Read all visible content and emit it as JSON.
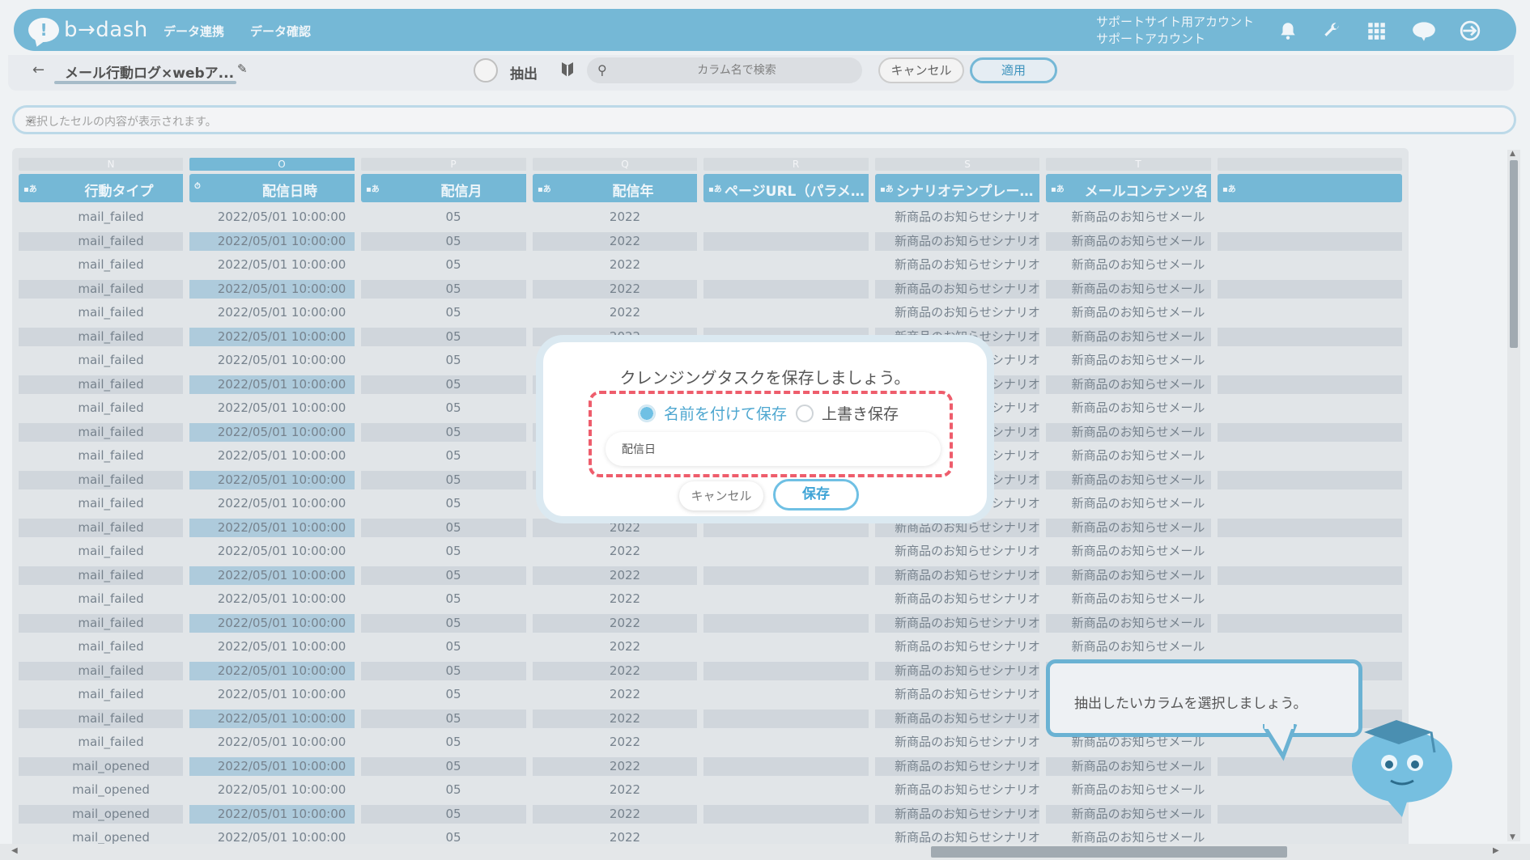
{
  "brand": {
    "logo_text": "b→dash",
    "accent": "#6ab2d3",
    "alert": "#ee5d6c"
  },
  "nav": {
    "links": [
      "データ連携",
      "データ確認"
    ],
    "account_line1": "サポートサイト用アカウント",
    "account_line2": "サポートアカウント",
    "icons": [
      "bell-icon",
      "wrench-icon",
      "grid-icon",
      "notification-cloud-icon",
      "logout-icon"
    ]
  },
  "toolbar": {
    "back": "←",
    "title": "メール行動ログ×webア...",
    "edit": "✎",
    "extract_label": "抽出",
    "search_placeholder": "カラム名で検索",
    "cancel_label": "キャンセル",
    "apply_label": "適用"
  },
  "cellbar": {
    "text": "選択したセルの内容が表示されます。",
    "chevron": "⌄"
  },
  "columns": [
    {
      "letter": "N",
      "type": "▪あ",
      "label": "行動タイプ",
      "selected": false
    },
    {
      "letter": "O",
      "type": "⏱",
      "label": "配信日時",
      "selected": true
    },
    {
      "letter": "P",
      "type": "▪あ",
      "label": "配信月",
      "selected": false
    },
    {
      "letter": "Q",
      "type": "▪あ",
      "label": "配信年",
      "selected": false
    },
    {
      "letter": "R",
      "type": "▪あ",
      "label": "ページURL（パラメ…",
      "selected": false
    },
    {
      "letter": "S",
      "type": "▪あ",
      "label": "シナリオテンプレー…",
      "selected": false
    },
    {
      "letter": "T",
      "type": "▪あ",
      "label": "メールコンテンツ名",
      "selected": false
    },
    {
      "letter": "",
      "type": "▪あ",
      "label": "",
      "selected": false
    }
  ],
  "rows": {
    "action_type": [
      "mail_failed",
      "mail_failed",
      "mail_failed",
      "mail_failed",
      "mail_failed",
      "mail_failed",
      "mail_failed",
      "mail_failed",
      "mail_failed",
      "mail_failed",
      "mail_failed",
      "mail_failed",
      "mail_failed",
      "mail_failed",
      "mail_failed",
      "mail_failed",
      "mail_failed",
      "mail_failed",
      "mail_failed",
      "mail_failed",
      "mail_failed",
      "mail_failed",
      "mail_failed",
      "mail_opened",
      "mail_opened",
      "mail_opened",
      "mail_opened"
    ],
    "sent_at": "2022/05/01 10:00:00",
    "month": "05",
    "year": "2022",
    "scenario": "新商品のお知らせシナリオ",
    "mail_content": "新商品のお知らせメール"
  },
  "modal": {
    "title": "クレンジングタスクを保存しましょう。",
    "option_named": "名前を付けて保存",
    "option_overwrite": "上書き保存",
    "name_value": "配信日",
    "cancel_label": "キャンセル",
    "save_label": "保存"
  },
  "tooltip": {
    "text": "抽出したいカラムを選択しましょう。"
  }
}
